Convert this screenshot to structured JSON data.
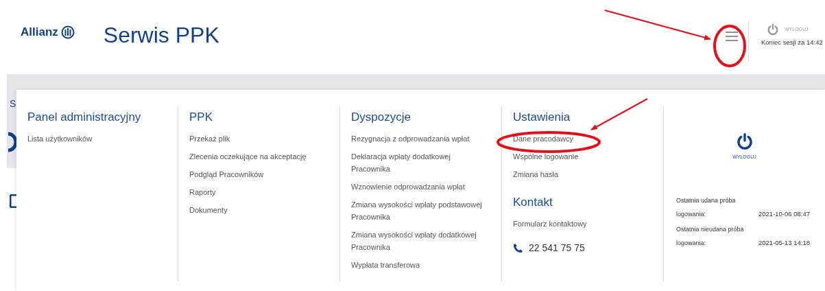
{
  "header": {
    "logo_text": "Allianz",
    "title": "Serwis PPK",
    "logout_label": "WYLOGUJ",
    "session": "Koniec sesji za 14:42"
  },
  "background_fragments": [
    "S"
  ],
  "menu": {
    "columns": [
      {
        "sections": [
          {
            "heading": "Panel administracyjny",
            "items": [
              "Lista użytkowników"
            ]
          }
        ]
      },
      {
        "sections": [
          {
            "heading": "PPK",
            "items": [
              "Przekaż plik",
              "Zlecenia oczekujące na akceptację",
              "Podgląd Pracowników",
              "Raporty",
              "Dokumenty"
            ]
          }
        ]
      },
      {
        "sections": [
          {
            "heading": "Dyspozycje",
            "items": [
              "Rezygnacja z odprowadzania wpłat",
              "Deklaracja wpłaty dodatkowej Pracownika",
              "Wznowienie odprowadzania wpłat",
              "Zmiana wysokości wpłaty podstawowej Pracownika",
              "Zmiana wysokości wpłaty dodatkowej Pracownika",
              "Wypłata transferowa"
            ]
          }
        ]
      },
      {
        "sections": [
          {
            "heading": "Ustawienia",
            "items": [
              "Dane pracodawcy",
              "Wspólne logowanie",
              "Zmiana hasła"
            ]
          },
          {
            "heading": "Kontakt",
            "items": [
              "Formularz kontaktowy"
            ],
            "phone": "22 541 75 75"
          }
        ]
      }
    ]
  },
  "account": {
    "logout_label": "WYLOGUJ",
    "login_info": [
      {
        "label": "Ostatnia udana próba logowania:",
        "value": "2021-10-06 08:47"
      },
      {
        "label": "Ostatnia nieudana próba logowania:",
        "value": "2021-05-13 14:18"
      }
    ]
  }
}
